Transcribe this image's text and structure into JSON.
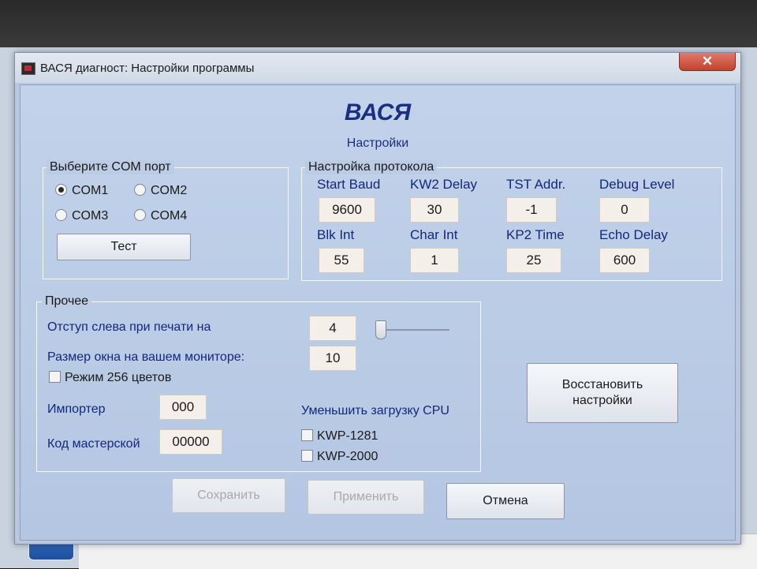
{
  "window": {
    "title": "ВАСЯ диагност: Настройки программы",
    "close_label": "✕"
  },
  "header": {
    "title": "ВАСЯ",
    "subtitle": "Настройки"
  },
  "com_group": {
    "legend": "Выберите COM порт",
    "options": [
      "COM1",
      "COM2",
      "COM3",
      "COM4"
    ],
    "selected": "COM1",
    "test_button": "Тест"
  },
  "protocol_group": {
    "legend": "Настройка протокола",
    "fields": [
      {
        "label": "Start Baud",
        "value": "9600"
      },
      {
        "label": "KW2 Delay",
        "value": "30"
      },
      {
        "label": "TST Addr.",
        "value": "-1"
      },
      {
        "label": "Debug Level",
        "value": "0"
      },
      {
        "label": "Blk Int",
        "value": "55"
      },
      {
        "label": "Char Int",
        "value": "1"
      },
      {
        "label": "KP2 Time",
        "value": "25"
      },
      {
        "label": "Echo Delay",
        "value": "600"
      }
    ]
  },
  "other_group": {
    "legend": "Прочее",
    "print_indent_label": "Отступ слева при печати на",
    "print_indent_value": "4",
    "window_size_label": "Размер окна на вашем мониторе:",
    "window_size_value": "10",
    "color_mode_label": "Режим 256 цветов",
    "importer_label": "Импортер",
    "importer_value": "000",
    "workshop_label": "Код мастерской",
    "workshop_value": "00000",
    "cpu_label": "Уменьшить загрузку CPU",
    "cpu_options": [
      "KWP-1281",
      "KWP-2000"
    ]
  },
  "restore_button": {
    "line1": "Восстановить",
    "line2": "настройки"
  },
  "footer": {
    "save": "Сохранить",
    "apply": "Применить",
    "cancel": "Отмена"
  },
  "colors": {
    "accent_text": "#1b2f80",
    "client_bg": "#b9c8de",
    "close_button": "#c4412f"
  }
}
